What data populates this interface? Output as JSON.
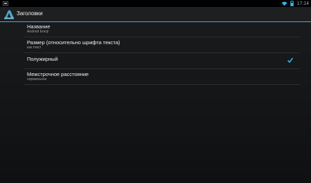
{
  "status_bar": {
    "time": "17:14"
  },
  "action_bar": {
    "title": "Заголовки"
  },
  "preferences": [
    {
      "title": "Название",
      "summary": "Android Emoji"
    },
    {
      "title": "Размер (относительно шрифта текста)",
      "summary": "как текст"
    },
    {
      "title": "Полужирный",
      "checked": true
    },
    {
      "title": "Межстрочное расстояние",
      "summary": "нормальное"
    }
  ],
  "colors": {
    "accent": "#33b5e5",
    "background": "#141516"
  }
}
